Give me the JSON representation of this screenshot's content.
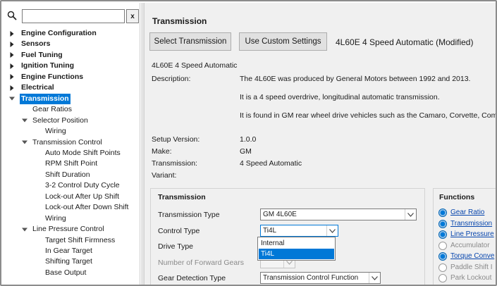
{
  "search": {
    "placeholder": "",
    "value": "",
    "clear_label": "x"
  },
  "tree": [
    {
      "label": "Engine Configuration",
      "bold": true,
      "arrow": "right"
    },
    {
      "label": "Sensors",
      "bold": true,
      "arrow": "right"
    },
    {
      "label": "Fuel Tuning",
      "bold": true,
      "arrow": "right"
    },
    {
      "label": "Ignition Tuning",
      "bold": true,
      "arrow": "right"
    },
    {
      "label": "Engine Functions",
      "bold": true,
      "arrow": "right"
    },
    {
      "label": "Electrical",
      "bold": true,
      "arrow": "right"
    },
    {
      "label": "Transmission",
      "bold": true,
      "arrow": "down",
      "selected": true
    },
    {
      "label": "Gear Ratios",
      "bold": false,
      "arrow": ""
    },
    {
      "label": "Selector Position",
      "bold": false,
      "arrow": "down"
    },
    {
      "label": "Wiring",
      "bold": false,
      "arrow": ""
    },
    {
      "label": "Transmission Control",
      "bold": false,
      "arrow": "down"
    },
    {
      "label": "Auto Mode Shift Points",
      "bold": false,
      "arrow": ""
    },
    {
      "label": "RPM Shift Point",
      "bold": false,
      "arrow": ""
    },
    {
      "label": "Shift Duration",
      "bold": false,
      "arrow": ""
    },
    {
      "label": "3-2 Control Duty Cycle",
      "bold": false,
      "arrow": ""
    },
    {
      "label": "Lock-out After Up Shift",
      "bold": false,
      "arrow": ""
    },
    {
      "label": "Lock-out After Down Shift",
      "bold": false,
      "arrow": ""
    },
    {
      "label": "Wiring",
      "bold": false,
      "arrow": ""
    },
    {
      "label": "Line Pressure Control",
      "bold": false,
      "arrow": "down"
    },
    {
      "label": "Target Shift Firmness",
      "bold": false,
      "arrow": ""
    },
    {
      "label": "In Gear Target",
      "bold": false,
      "arrow": ""
    },
    {
      "label": "Shifting Target",
      "bold": false,
      "arrow": ""
    },
    {
      "label": "Base Output",
      "bold": false,
      "arrow": ""
    }
  ],
  "header": {
    "title": "Transmission",
    "select_button": "Select Transmission",
    "custom_button": "Use Custom Settings",
    "selected_label": "4L60E 4 Speed Automatic (Modified)"
  },
  "info": {
    "name": "4L60E 4 Speed Automatic",
    "description_label": "Description:",
    "description_lines": [
      "The 4L60E was produced  by General Motors between 1992 and 2013.",
      "It is a 4 speed overdrive, longitudinal automatic transmission.",
      "It is found in GM rear wheel drive vehicles such as the Camaro, Corvette, Comm"
    ],
    "setup_version_label": "Setup Version:",
    "setup_version": "1.0.0",
    "make_label": "Make:",
    "make": "GM",
    "transmission_label": "Transmission:",
    "transmission": "4 Speed Automatic",
    "variant_label": "Variant:",
    "variant": ""
  },
  "group": {
    "title": "Transmission",
    "type_label": "Transmission Type",
    "type_value": "GM 4L60E",
    "control_label": "Control Type",
    "control_value": "Ti4L",
    "drive_label": "Drive Type",
    "gears_label": "Number of Forward Gears",
    "gear_detect_label": "Gear Detection Type",
    "gear_detect_value": "Transmission Control Function",
    "dropdown_options": [
      "Internal",
      "Ti4L"
    ],
    "dropdown_highlight": 1
  },
  "functions": {
    "title": "Functions",
    "items": [
      {
        "label": "Gear Ratio",
        "on": true
      },
      {
        "label": "Transmission",
        "on": true
      },
      {
        "label": "Line Pressure",
        "on": true
      },
      {
        "label": "Accumulator",
        "on": false
      },
      {
        "label": "Torque Conve",
        "on": true
      },
      {
        "label": "Paddle Shift I",
        "on": false
      },
      {
        "label": "Park Lockout",
        "on": false
      }
    ]
  },
  "colors": {
    "accent": "#0078d7",
    "panel_bg": "#f0f0f0",
    "link": "#0645ad"
  }
}
